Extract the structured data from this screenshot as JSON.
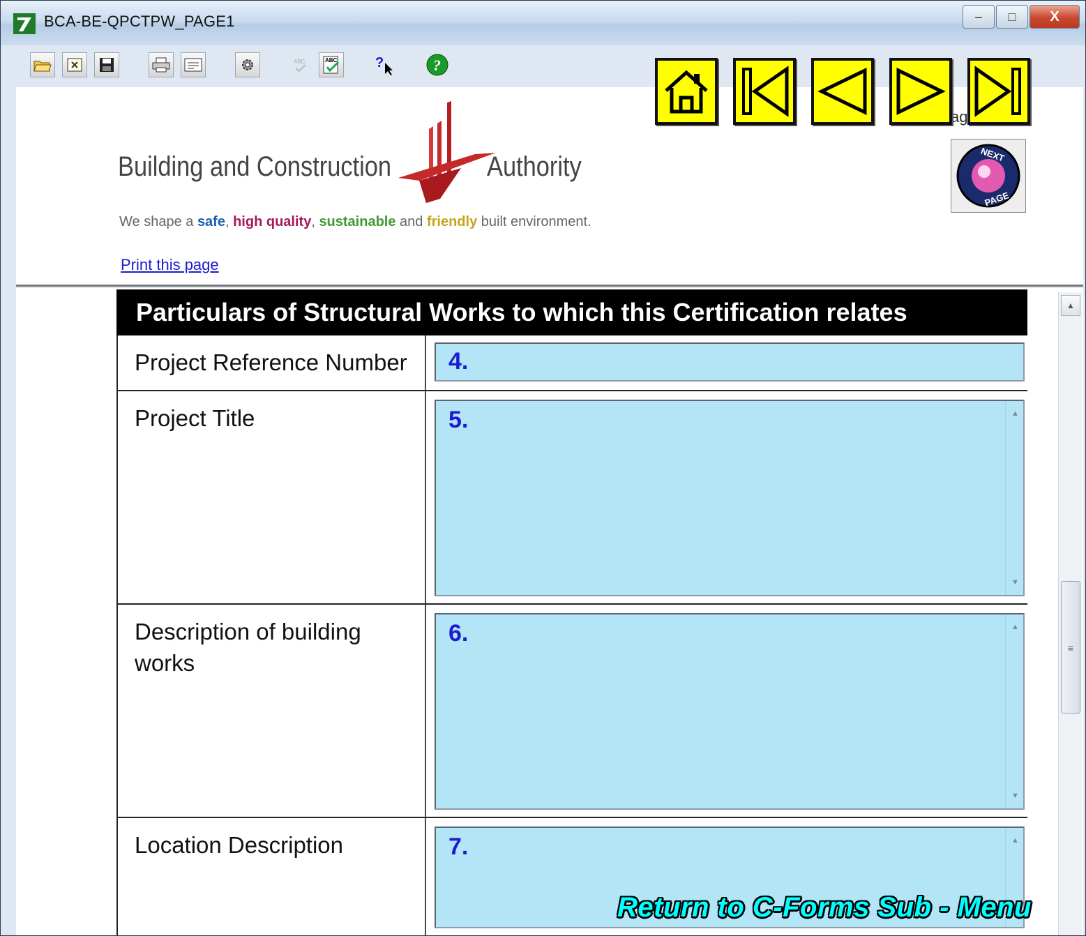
{
  "window": {
    "title": "BCA-BE-QPCTPW_PAGE1",
    "controls": {
      "minimize": "–",
      "maximize": "□",
      "close": "X"
    }
  },
  "toolbar": {
    "icons": [
      "open-folder-icon",
      "close-form-icon",
      "save-icon",
      "print-icon",
      "form-view-icon",
      "settings-icon",
      "spellcheck-disabled-icon",
      "spellcheck-icon",
      "context-help-icon",
      "help-icon"
    ]
  },
  "nav": {
    "buttons": [
      "home-icon",
      "first-page-icon",
      "previous-page-icon",
      "next-page-icon",
      "last-page-icon"
    ],
    "color": "#ffff00"
  },
  "header": {
    "logo_left": "Building and Construction",
    "logo_right": "Authority",
    "tagline": {
      "prefix": "We shape a ",
      "safe": "safe",
      "sep1": ", ",
      "high_quality": "high quality",
      "sep2": ", ",
      "sustainable": "sustainable",
      "and": " and ",
      "friendly": "friendly",
      "suffix": " built environment."
    },
    "print_link": "Print this page",
    "page_label_partial": "ag",
    "next_page_badge": {
      "top": "NEXT",
      "bottom": "PAGE"
    }
  },
  "form": {
    "section_title": "Particulars of Structural Works to which this Certification relates",
    "rows": [
      {
        "label": "Project Reference Number",
        "number": "4."
      },
      {
        "label": "Project Title",
        "number": "5."
      },
      {
        "label": "Description of building works",
        "number": "6."
      },
      {
        "label": "Location Description",
        "number": "7."
      }
    ],
    "field_color": "#b3e5f7"
  },
  "footer": {
    "return_menu": "Return to C-Forms Sub - Menu"
  }
}
